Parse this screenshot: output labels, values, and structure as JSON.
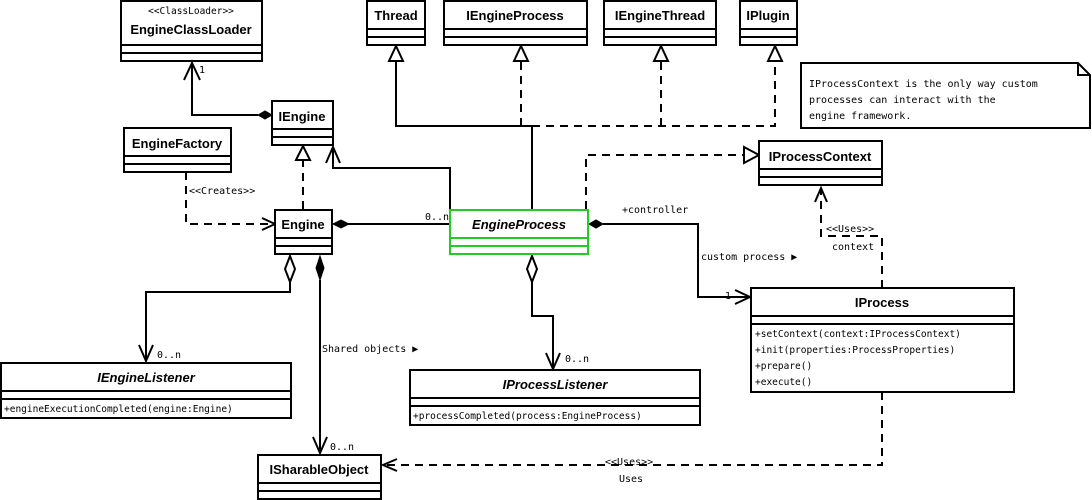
{
  "classes": {
    "engine_class_loader": {
      "stereotype": "<<ClassLoader>>",
      "name": "EngineClassLoader"
    },
    "thread": {
      "name": "Thread"
    },
    "iengine_process": {
      "name": "IEngineProcess"
    },
    "iengine_thread": {
      "name": "IEngineThread"
    },
    "iplugin": {
      "name": "IPlugin"
    },
    "iengine": {
      "name": "IEngine"
    },
    "engine_factory": {
      "name": "EngineFactory"
    },
    "engine": {
      "name": "Engine"
    },
    "engine_process": {
      "name": "EngineProcess",
      "highlight_color": "#22cc22"
    },
    "iprocess_context": {
      "name": "IProcessContext"
    },
    "iprocess": {
      "name": "IProcess",
      "methods": [
        "+setContext(context:IProcessContext)",
        "+init(properties:ProcessProperties)",
        "+prepare()",
        "+execute()"
      ]
    },
    "iengine_listener": {
      "name": "IEngineListener",
      "methods": [
        "+engineExecutionCompleted(engine:Engine)"
      ]
    },
    "iprocess_listener": {
      "name": "IProcessListener",
      "methods": [
        "+processCompleted(process:EngineProcess)"
      ]
    },
    "isharable_object": {
      "name": "ISharableObject"
    }
  },
  "note": {
    "lines": [
      "IProcessContext is the only way custom",
      "processes can interact with the",
      "engine framework."
    ]
  },
  "labels": {
    "loader_mult": "1",
    "creates": "<<Creates>>",
    "engine_process_mult": "0..n",
    "controller": "+controller",
    "custom_process": "custom process ▶",
    "iprocess_mult": "1",
    "uses_context_stereo": "<<Uses>>",
    "context": "context",
    "listener_mult": "0..n",
    "shared_objects": "Shared objects ▶",
    "shared_mult": "0..n",
    "process_listener_mult": "0..n",
    "uses_shared_stereo": "<<Uses>>",
    "uses_shared": "Uses"
  }
}
